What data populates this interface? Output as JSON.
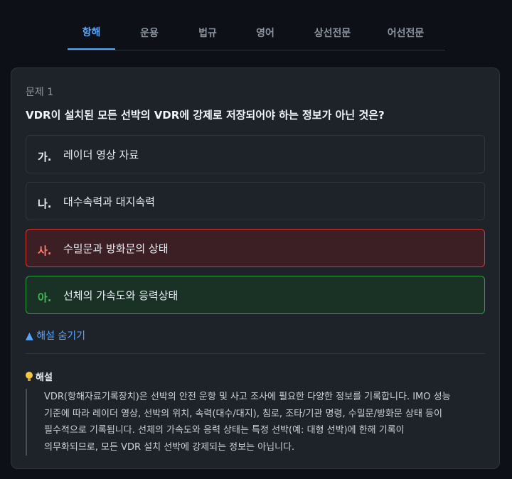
{
  "tabs": [
    {
      "label": "항해",
      "active": true
    },
    {
      "label": "운용",
      "active": false
    },
    {
      "label": "법규",
      "active": false
    },
    {
      "label": "영어",
      "active": false
    },
    {
      "label": "상선전문",
      "active": false
    },
    {
      "label": "어선전문",
      "active": false
    }
  ],
  "question": {
    "number_label": "문제 1",
    "text": "VDR이 설치된 모든 선박의 VDR에 강제로 저장되어야 하는 정보가 아닌 것은?"
  },
  "options": [
    {
      "letter": "가.",
      "text": "레이더 영상 자료",
      "state": "default"
    },
    {
      "letter": "나.",
      "text": "대수속력과 대지속력",
      "state": "default"
    },
    {
      "letter": "사.",
      "text": "수밀문과 방화문의 상태",
      "state": "wrong"
    },
    {
      "letter": "아.",
      "text": "선체의 가속도와 응력상태",
      "state": "correct"
    }
  ],
  "explanation": {
    "toggle_label": "▲ 해설 숨기기",
    "title": "해설",
    "icon": "lightbulb-icon",
    "lines": [
      "VDR(항해자료기록장치)은 선박의 안전 운항 및 사고 조사에 필요한 다양한 정보를 기록합니다. IMO 성능",
      "기준에 따라 레이더 영상, 선박의 위치, 속력(대수/대지), 침로, 조타/기관 명령, 수밀문/방화문 상태 등이",
      "필수적으로 기록됩니다. 선체의 가속도와 응력 상태는 특정 선박(예: 대형 선박)에 한해 기록이",
      "의무화되므로, 모든 VDR 설치 선박에 강제되는 정보는 아닙니다."
    ]
  },
  "colors": {
    "background": "#0d1117",
    "card": "#1e2229",
    "accent": "#58a6ff",
    "wrong": "#da3633",
    "correct": "#2ea043"
  }
}
